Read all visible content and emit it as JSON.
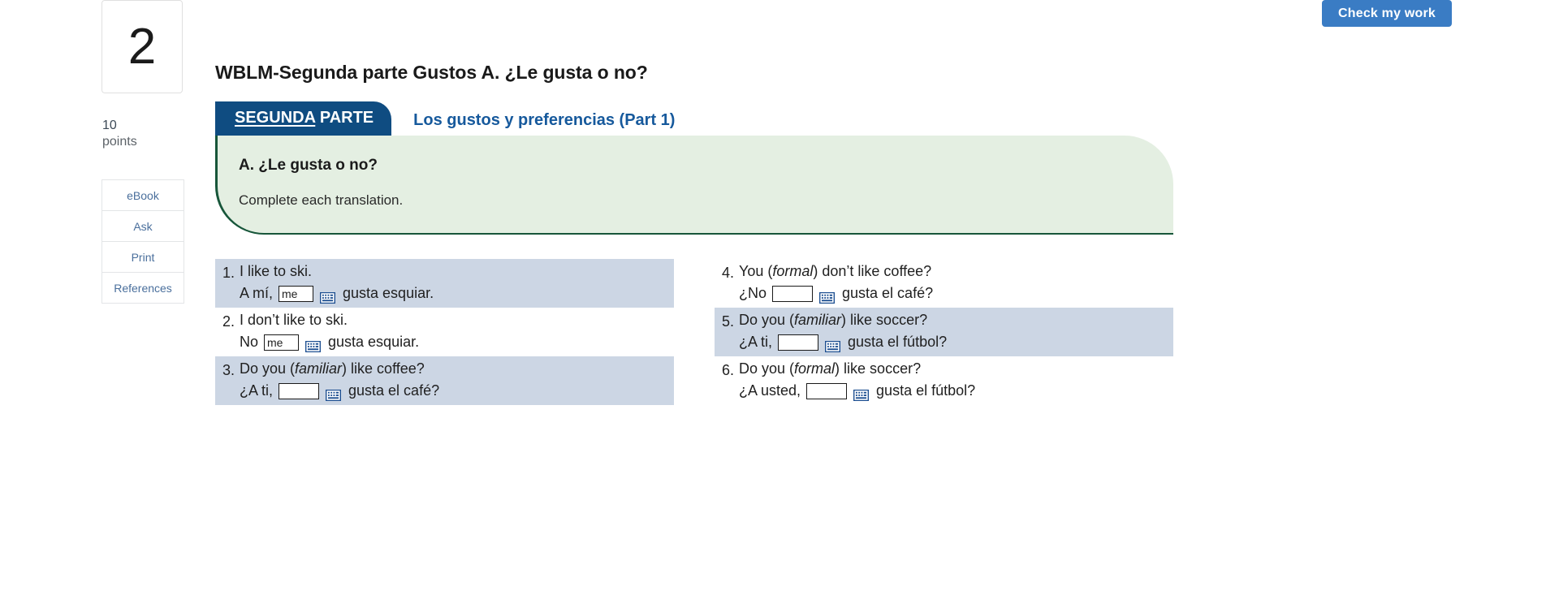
{
  "toolbar": {
    "check_work_label": "Check my work"
  },
  "left_rail": {
    "question_number": "2",
    "points_value": "10",
    "points_label": "points",
    "buttons": [
      {
        "label": "eBook",
        "name": "ebook"
      },
      {
        "label": "Ask",
        "name": "ask"
      },
      {
        "label": "Print",
        "name": "print"
      },
      {
        "label": "References",
        "name": "references"
      }
    ]
  },
  "header": {
    "assignment_title": "WBLM-Segunda parte Gustos A. ¿Le gusta o no?"
  },
  "tabs": {
    "active": {
      "label_underlined": "SEGUNDA",
      "label_rest": " PARTE"
    },
    "inactive": {
      "label": "Los gustos y preferencias (Part 1)"
    }
  },
  "instructions": {
    "title": "A. ¿Le gusta o no?",
    "subtitle": "Complete each translation."
  },
  "exercises": {
    "left_column": [
      {
        "number": "1.",
        "english_pre": "I like to ski.",
        "english_italic": "",
        "english_post": "",
        "answer_pre": "A mí,",
        "answer_value": "me",
        "answer_post": "gusta esquiar.",
        "shaded": true,
        "icon": "keyboard-icon"
      },
      {
        "number": "2.",
        "english_pre": "I don’t like to ski.",
        "english_italic": "",
        "english_post": "",
        "answer_pre": "No",
        "answer_value": "me",
        "answer_post": "gusta esquiar.",
        "shaded": false,
        "icon": "keyboard-icon"
      },
      {
        "number": "3.",
        "english_pre": "Do you (",
        "english_italic": "familiar",
        "english_post": ") like coffee?",
        "answer_pre": "¿A ti,",
        "answer_value": "",
        "answer_post": "gusta el café?",
        "shaded": true,
        "icon": "keyboard-icon"
      }
    ],
    "right_column": [
      {
        "number": "4.",
        "english_pre": "You (",
        "english_italic": "formal",
        "english_post": ") don’t like coffee?",
        "answer_pre": "¿No",
        "answer_value": "",
        "answer_post": "gusta el café?",
        "shaded": false,
        "icon": "keyboard-icon"
      },
      {
        "number": "5.",
        "english_pre": "Do you (",
        "english_italic": "familiar",
        "english_post": ") like soccer?",
        "answer_pre": "¿A ti,",
        "answer_value": "",
        "answer_post": "gusta el fútbol?",
        "shaded": true,
        "icon": "keyboard-icon"
      },
      {
        "number": "6.",
        "english_pre": "Do you (",
        "english_italic": "formal",
        "english_post": ") like soccer?",
        "answer_pre": "¿A usted,",
        "answer_value": "",
        "answer_post": "gusta el fútbol?",
        "shaded": false,
        "icon": "keyboard-icon"
      }
    ]
  },
  "colors": {
    "tab_active_bg": "#0f4c81",
    "tab_inactive_text": "#16599c",
    "instruction_bg": "#e4efe2",
    "instruction_border": "#17563a",
    "row_shade": "#ccd6e4",
    "button_blue": "#3a7cc4"
  }
}
